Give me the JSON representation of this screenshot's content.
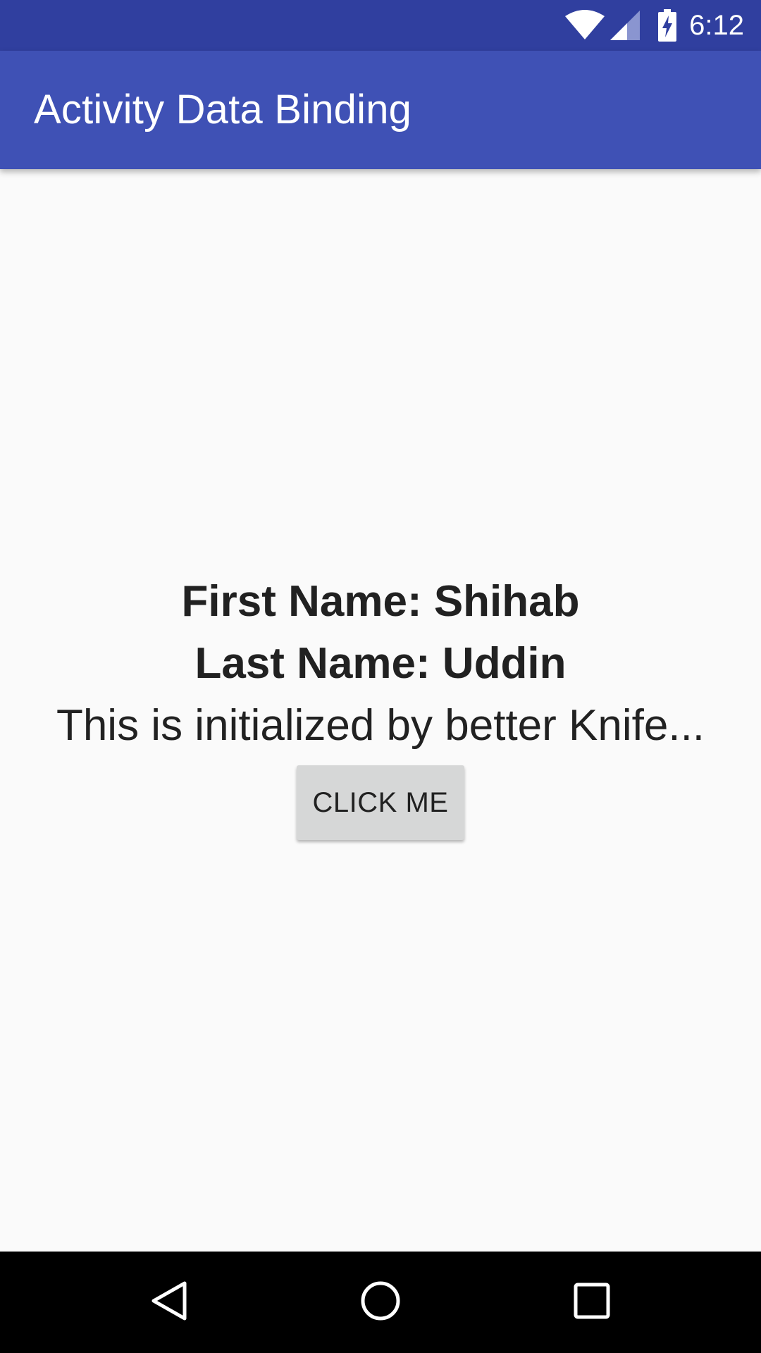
{
  "status_bar": {
    "time": "6:12",
    "icons": [
      "wifi-icon",
      "cell-signal-icon",
      "battery-charging-icon"
    ],
    "color": "#303f9f"
  },
  "app_bar": {
    "title": "Activity Data Binding",
    "color": "#3f51b5"
  },
  "main": {
    "first_name": "First Name: Shihab",
    "last_name": "Last Name: Uddin",
    "description": "This is initialized by better Knife...",
    "button_label": "CLICK ME"
  },
  "nav_bar": {
    "icons": [
      "back-icon",
      "home-icon",
      "recents-icon"
    ]
  }
}
